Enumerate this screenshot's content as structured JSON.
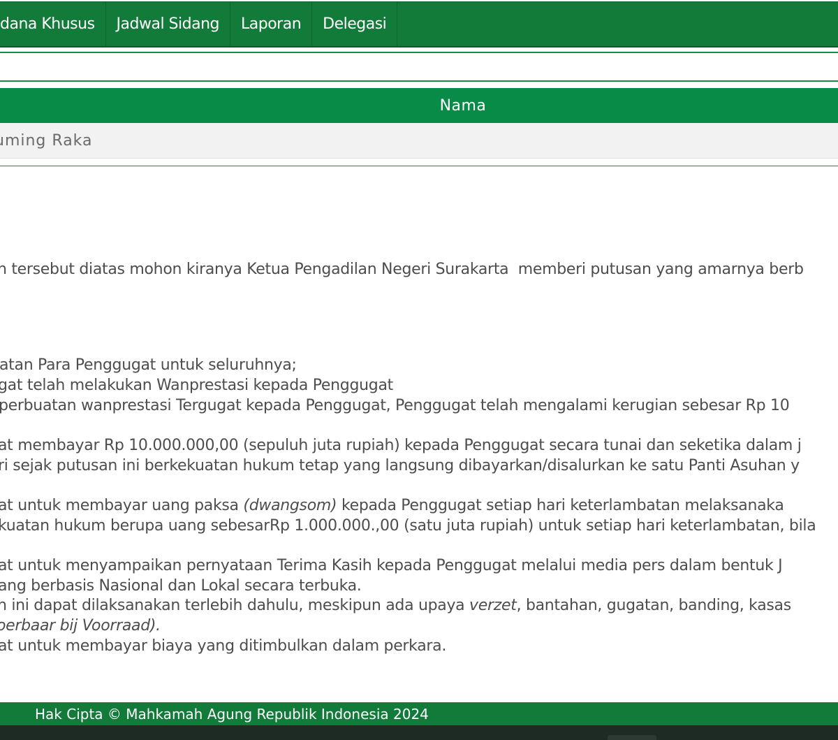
{
  "nav": {
    "items": [
      "dana Khusus",
      "Jadwal Sidang",
      "Laporan",
      "Delegasi"
    ]
  },
  "table": {
    "header": "Nama",
    "rows": [
      "uming Raka"
    ]
  },
  "petitum": {
    "intro": "n tersebut diatas mohon kiranya Ketua Pengadilan Negeri Surakarta  memberi putusan yang amarnya berb",
    "lines": [
      "atan Para Penggugat untuk seluruhnya;",
      "gat telah melakukan Wanprestasi kepada Penggugat",
      "perbuatan wanprestasi Tergugat kepada Penggugat, Penggugat telah mengalami kerugian sebesar Rp 10",
      "at membayar Rp 10.000.000,00 (sepuluh juta rupiah) kepada Penggugat secara tunai dan seketika dalam j",
      "ri sejak putusan ini berkekuatan hukum tetap yang langsung dibayarkan/disalurkan ke satu Panti Asuhan y",
      "at untuk membayar uang paksa ",
      "(dwangsom)",
      " kepada Penggugat setiap hari keterlambatan melaksanaka",
      "kuatan hukum berupa uang sebesarRp 1.000.000.,00 (satu juta rupiah) untuk setiap hari keterlambatan, bila",
      "at untuk menyampaikan pernyataan Terima Kasih kepada Penggugat melalui media pers dalam bentuk J",
      "ang berbasis Nasional dan Lokal secara terbuka.",
      "n ini dapat dilaksanakan terlebih dahulu, meskipun ada upaya ",
      "verzet",
      ", bantahan, gugatan, banding, kasas",
      "oerbaar bij Voorraad).",
      "at untuk membayar biaya yang ditimbulkan dalam perkara."
    ]
  },
  "footer": {
    "text": "Hak Cipta © Mahkamah Agung Republik Indonesia 2024"
  },
  "colors": {
    "nav_bg": "#137b3a",
    "table_header_bg": "#088b47",
    "row_bg": "#f2f2f2",
    "footer_bg": "#137b3a"
  }
}
